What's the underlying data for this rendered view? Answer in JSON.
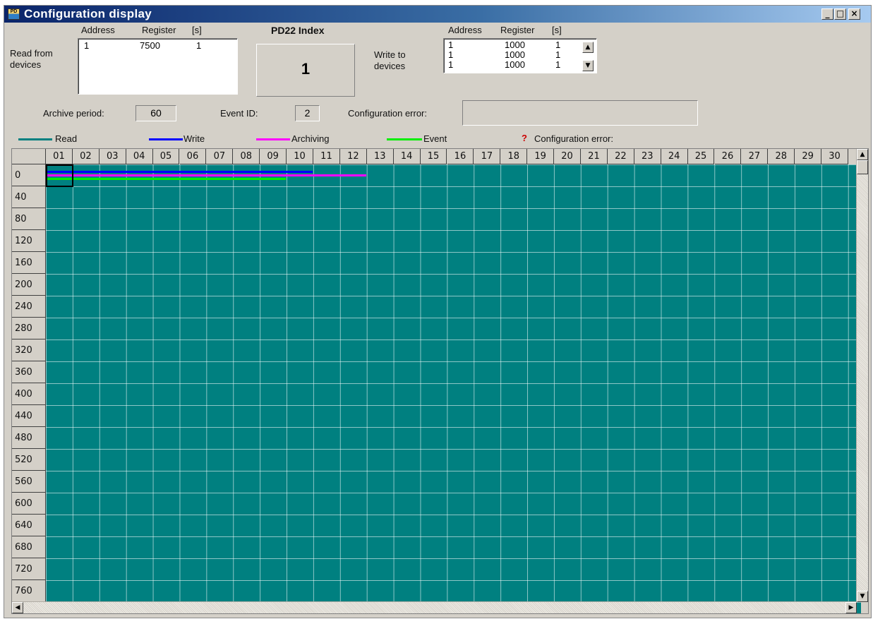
{
  "window": {
    "title": "Configuration display",
    "icon_label": "PD",
    "minimize_glyph": "_",
    "maximize_glyph": "□",
    "close_glyph": "×"
  },
  "read": {
    "label_line1": "Read from",
    "label_line2": "devices",
    "col_address": "Address",
    "col_register": "Register",
    "col_seconds": "[s]",
    "rows": [
      {
        "address": "1",
        "register": "7500",
        "seconds": "1"
      }
    ]
  },
  "index": {
    "label": "PD22 Index",
    "value": "1"
  },
  "write": {
    "label_line1": "Write to",
    "label_line2": "devices",
    "col_address": "Address",
    "col_register": "Register",
    "col_seconds": "[s]",
    "rows": [
      {
        "address": "1",
        "register": "1000",
        "seconds": "1"
      },
      {
        "address": "1",
        "register": "1000",
        "seconds": "1"
      },
      {
        "address": "1",
        "register": "1000",
        "seconds": "1"
      }
    ],
    "scroll_up_glyph": "▲",
    "scroll_down_glyph": "▼"
  },
  "status": {
    "archive_label": "Archive period:",
    "archive_value": "60",
    "event_label": "Event ID:",
    "event_value": "2",
    "config_error_label": "Configuration error:",
    "config_error_value": ""
  },
  "legend": [
    {
      "label": "Read",
      "color": "#008080"
    },
    {
      "label": "Write",
      "color": "#0000ff"
    },
    {
      "label": "Archiving",
      "color": "#ff00ff"
    },
    {
      "label": "Event",
      "color": "#00ee00"
    }
  ],
  "legend_error": {
    "glyph": "?",
    "label": "Configuration error:",
    "color": "#cc0000"
  },
  "grid": {
    "columns": [
      "01",
      "02",
      "03",
      "04",
      "05",
      "06",
      "07",
      "08",
      "09",
      "10",
      "11",
      "12",
      "13",
      "14",
      "15",
      "16",
      "17",
      "18",
      "19",
      "20",
      "21",
      "22",
      "23",
      "24",
      "25",
      "26",
      "27",
      "28",
      "29",
      "30"
    ],
    "rows": [
      "0",
      "40",
      "80",
      "120",
      "160",
      "200",
      "240",
      "280",
      "320",
      "360",
      "400",
      "440",
      "480",
      "520",
      "560",
      "600",
      "640",
      "680",
      "720",
      "760"
    ],
    "cell_color": "#008080",
    "bars": [
      {
        "type": "Read",
        "row": 0,
        "offset": 1,
        "col_start": 1,
        "col_end": 1,
        "color": "#008080"
      },
      {
        "type": "Write",
        "row": 0,
        "offset": 2,
        "col_start": 1,
        "col_end": 10,
        "color": "#0000ff"
      },
      {
        "type": "Archiving",
        "row": 0,
        "offset": 3,
        "col_start": 1,
        "col_end": 12,
        "color": "#ff00ff"
      },
      {
        "type": "Event",
        "row": 0,
        "offset": 4,
        "col_start": 1,
        "col_end": 9,
        "color": "#00ee00"
      }
    ],
    "selected": {
      "row": 0,
      "col": 1
    }
  },
  "scrollbars": {
    "up_glyph": "▲",
    "down_glyph": "▼",
    "left_glyph": "◀",
    "right_glyph": "▶"
  }
}
